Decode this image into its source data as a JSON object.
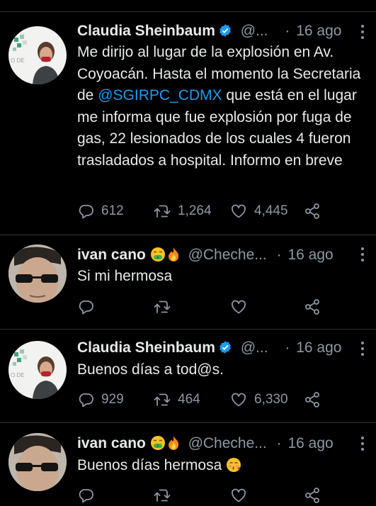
{
  "tweets": [
    {
      "author_name": "Claudia Sheinbaum",
      "handle": "@...",
      "dot": "·",
      "date": "16 ago",
      "text_before": "Me dirijo al lugar de la explosión en Av. Coyoacán. Hasta el momento la Secretaria de ",
      "mention": "@SGIRPC_CDMX",
      "text_after": " que está en el lugar me informa que fue explosión por fuga de gas, 22 lesionados de los cuales 4 fueron trasladados a hospital. Informo en breve",
      "replies": "612",
      "retweets": "1,264",
      "likes": "4,445"
    },
    {
      "author_name": "ivan cano",
      "handle": "@Cheche...",
      "dot": "·",
      "date": "16 ago",
      "text": "Si mi hermosa",
      "replies": "",
      "retweets": "",
      "likes": ""
    },
    {
      "author_name": "Claudia Sheinbaum",
      "handle": "@...",
      "dot": "·",
      "date": "16 ago",
      "text": "Buenos días a tod@s.",
      "replies": "929",
      "retweets": "464",
      "likes": "6,330"
    },
    {
      "author_name": "ivan cano",
      "handle": "@Cheche...",
      "dot": "·",
      "date": "16 ago",
      "text": "Buenos días hermosa",
      "replies": "",
      "retweets": "",
      "likes": ""
    }
  ],
  "colors": {
    "background": "#000000",
    "text": "#e7e9ea",
    "muted": "#8b98a5",
    "mention": "#1d9bf0",
    "verified": "#1d9bf0",
    "divider": "#2f3336"
  },
  "icons": [
    "verified-badge-icon",
    "money-mouth-emoji-icon",
    "fire-emoji-icon",
    "kissing-face-emoji-icon",
    "reply-icon",
    "retweet-icon",
    "like-icon",
    "share-icon",
    "more-icon"
  ]
}
